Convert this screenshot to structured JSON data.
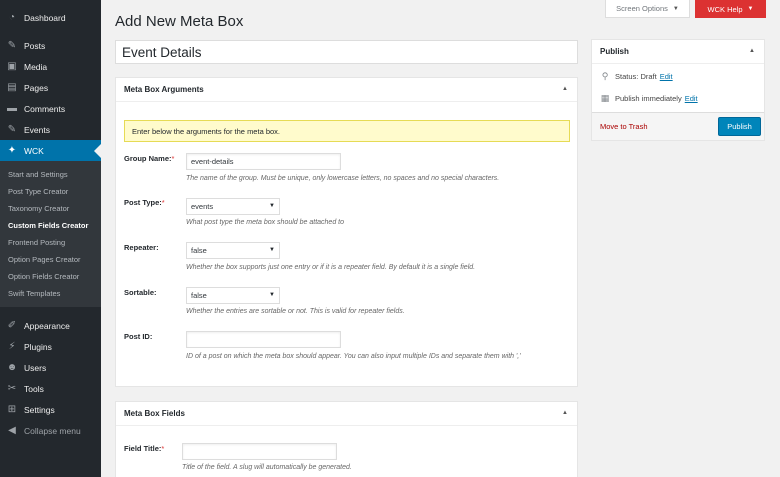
{
  "sidebar": {
    "top_items": [
      {
        "label": "Dashboard",
        "icon": "dashboard-icon"
      },
      {
        "label": "Posts",
        "icon": "pin-icon"
      },
      {
        "label": "Media",
        "icon": "media-icon"
      },
      {
        "label": "Pages",
        "icon": "pages-icon"
      },
      {
        "label": "Comments",
        "icon": "comments-icon"
      },
      {
        "label": "Events",
        "icon": "pin-icon"
      },
      {
        "label": "WCK",
        "icon": "wck-icon"
      }
    ],
    "submenu": [
      "Start and Settings",
      "Post Type Creator",
      "Taxonomy Creator",
      "Custom Fields Creator",
      "Frontend Posting",
      "Option Pages Creator",
      "Option Fields Creator",
      "Swift Templates"
    ],
    "bottom_items": [
      {
        "label": "Appearance",
        "icon": "appearance-icon"
      },
      {
        "label": "Plugins",
        "icon": "plugins-icon"
      },
      {
        "label": "Users",
        "icon": "users-icon"
      },
      {
        "label": "Tools",
        "icon": "tools-icon"
      },
      {
        "label": "Settings",
        "icon": "settings-icon"
      }
    ],
    "collapse_label": "Collapse menu"
  },
  "top_buttons": {
    "screen_options": "Screen Options",
    "wck_help": "WCK Help"
  },
  "page": {
    "title": "Add New Meta Box",
    "title_input": "Event Details"
  },
  "args_box": {
    "heading": "Meta Box Arguments",
    "notice": "Enter below the arguments for the meta box.",
    "group_name": {
      "label": "Group Name:",
      "required": "*",
      "value": "event-details",
      "desc": "The name of the group. Must be unique, only lowercase letters, no spaces and no special characters."
    },
    "post_type": {
      "label": "Post Type:",
      "required": "*",
      "value": "events",
      "desc": "What post type the meta box should be attached to"
    },
    "repeater": {
      "label": "Repeater:",
      "value": "false",
      "desc": "Whether the box supports just one entry or if it is a repeater field. By default it is a single field."
    },
    "sortable": {
      "label": "Sortable:",
      "value": "false",
      "desc": "Whether the entries are sortable or not. This is valid for repeater fields."
    },
    "post_id": {
      "label": "Post ID:",
      "value": "",
      "desc": "ID of a post on which the meta box should appear. You can also input multiple IDs and separate them with ','"
    }
  },
  "fields_box": {
    "heading": "Meta Box Fields",
    "field_title": {
      "label": "Field Title:",
      "required": "*",
      "value": "",
      "desc": "Title of the field. A slug will automatically be generated."
    }
  },
  "publish": {
    "heading": "Publish",
    "status_label": "Status:",
    "status_value": "Draft",
    "status_edit": "Edit",
    "schedule_label": "Publish",
    "schedule_value": "immediately",
    "schedule_edit": "Edit",
    "trash": "Move to Trash",
    "button": "Publish"
  },
  "colors": {
    "sidebar_bg": "#23282d",
    "accent": "#0073aa",
    "help_red": "#dc3232",
    "notice_bg": "#fffbcc"
  }
}
